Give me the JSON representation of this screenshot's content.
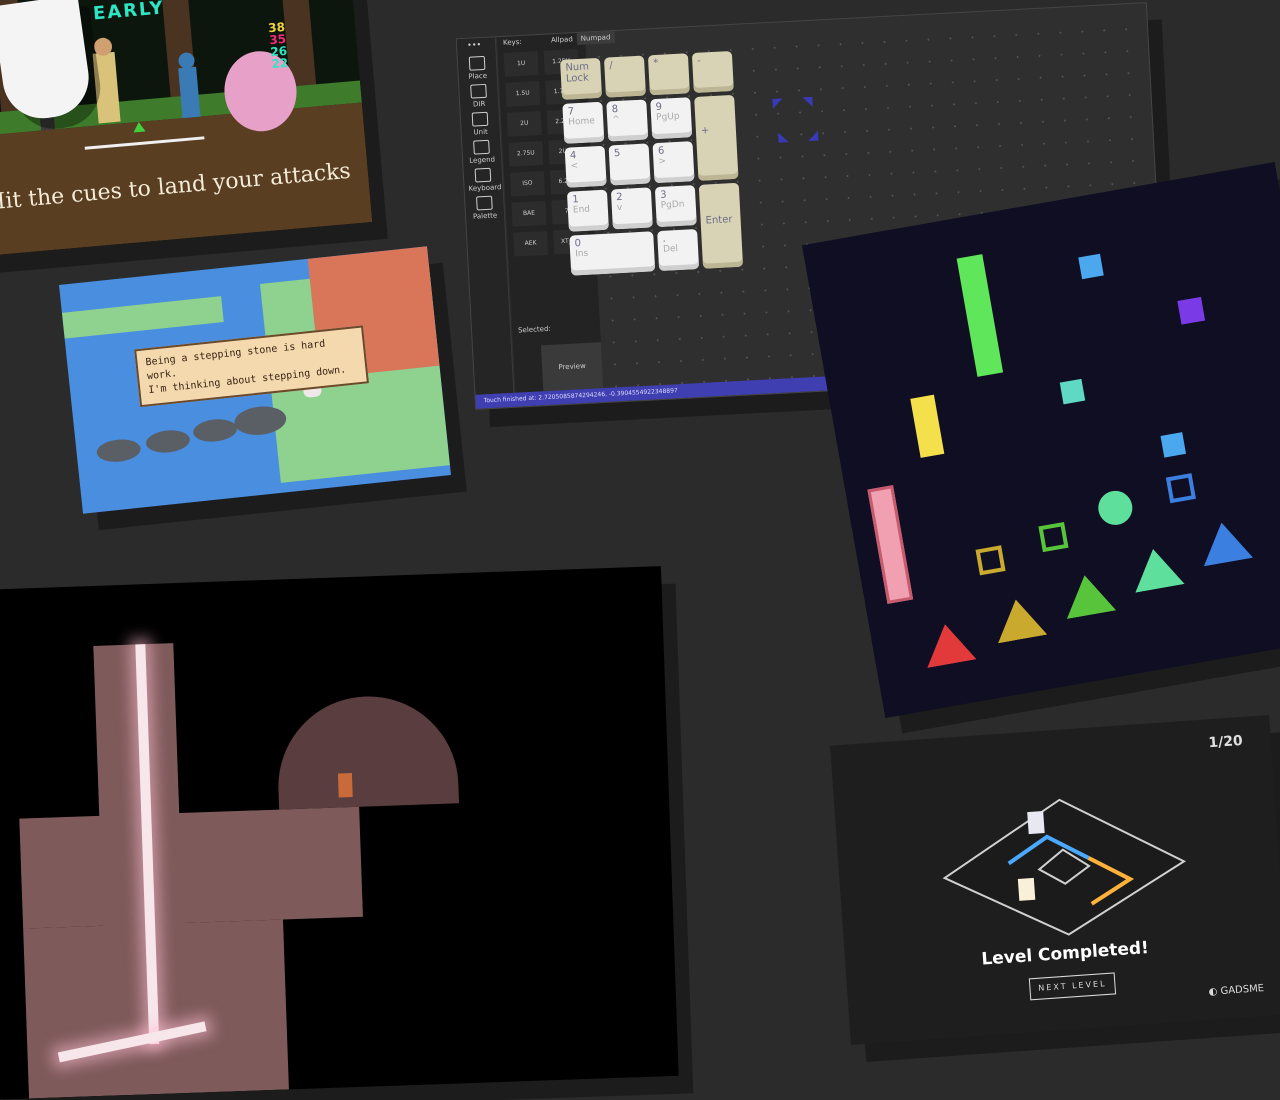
{
  "fight_game": {
    "caption": "Hit the cues to land your attacks",
    "timing_label": "EARLY",
    "scores": [
      "38",
      "35",
      "26",
      "22"
    ],
    "colors": {
      "caption": "#f4ecd8",
      "timing": "#2ee6c4"
    }
  },
  "rpg_game": {
    "dialog_line1": "Being a stepping stone is hard work.",
    "dialog_line2": "I'm thinking about stepping down."
  },
  "keyboard_editor": {
    "sidebar_tools": [
      {
        "label": "Place",
        "icon": "crosshair-icon"
      },
      {
        "label": "DIR",
        "icon": "direction-icon"
      },
      {
        "label": "Unit",
        "icon": "triangle-icon"
      },
      {
        "label": "Legend",
        "icon": "legend-icon"
      },
      {
        "label": "Keyboard",
        "icon": "keyboard-icon"
      },
      {
        "label": "Palette",
        "icon": "palette-icon"
      }
    ],
    "menu_dots": "•••",
    "keys_header": "Keys:",
    "key_sizes": [
      "1U",
      "1.25U",
      "1.5U",
      "1.75U",
      "2U",
      "2.25U",
      "2.75U",
      "2U V",
      "ISO",
      "6.25U",
      "BAE",
      "7U",
      "AEK",
      "XT_2U"
    ],
    "tabs": [
      "Allpad",
      "Numpad"
    ],
    "active_tab": "Numpad",
    "selected_label": "Selected:",
    "preview_label": "Preview",
    "status": "Touch finished at: 2.7205085874294246, -0.3904554922348897",
    "numpad": [
      {
        "main": "Num",
        "sub": "Lock"
      },
      {
        "main": "/",
        "sub": ""
      },
      {
        "main": "*",
        "sub": ""
      },
      {
        "main": "-",
        "sub": ""
      },
      {
        "main": "7",
        "sub": "Home"
      },
      {
        "main": "8",
        "sub": "^"
      },
      {
        "main": "9",
        "sub": "PgUp"
      },
      {
        "main": "+",
        "sub": ""
      },
      {
        "main": "4",
        "sub": "<"
      },
      {
        "main": "5",
        "sub": ""
      },
      {
        "main": "6",
        "sub": ">"
      },
      {
        "main": "1",
        "sub": "End"
      },
      {
        "main": "2",
        "sub": "v"
      },
      {
        "main": "3",
        "sub": "PgDn"
      },
      {
        "main": "Enter",
        "sub": ""
      },
      {
        "main": "0",
        "sub": "Ins"
      },
      {
        "main": ".",
        "sub": "Del"
      }
    ],
    "colors": {
      "status_bar": "#3f3fb2",
      "cream_key": "#d8d3b4",
      "white_key": "#f2f2f2"
    }
  },
  "invaders_game": {
    "colors": {
      "red": "#e23a3a",
      "gold": "#c9a92e",
      "green": "#58c43c",
      "mint": "#5ee09c",
      "blue": "#3b7fe0",
      "purple": "#7a3ae6",
      "pink": "#f0a0b0",
      "yellow": "#f3e04a",
      "lime": "#5fe65a",
      "cyan": "#5fd8c4",
      "sky": "#4ba8ee"
    }
  },
  "cave_game": {
    "colors": {
      "stone": "#7e5a5b",
      "beam": "#f7e6ea"
    }
  },
  "puzzle_game": {
    "level_counter": "1/20",
    "title": "Level Completed!",
    "next_button": "NEXT LEVEL",
    "brand": "GADSME"
  }
}
